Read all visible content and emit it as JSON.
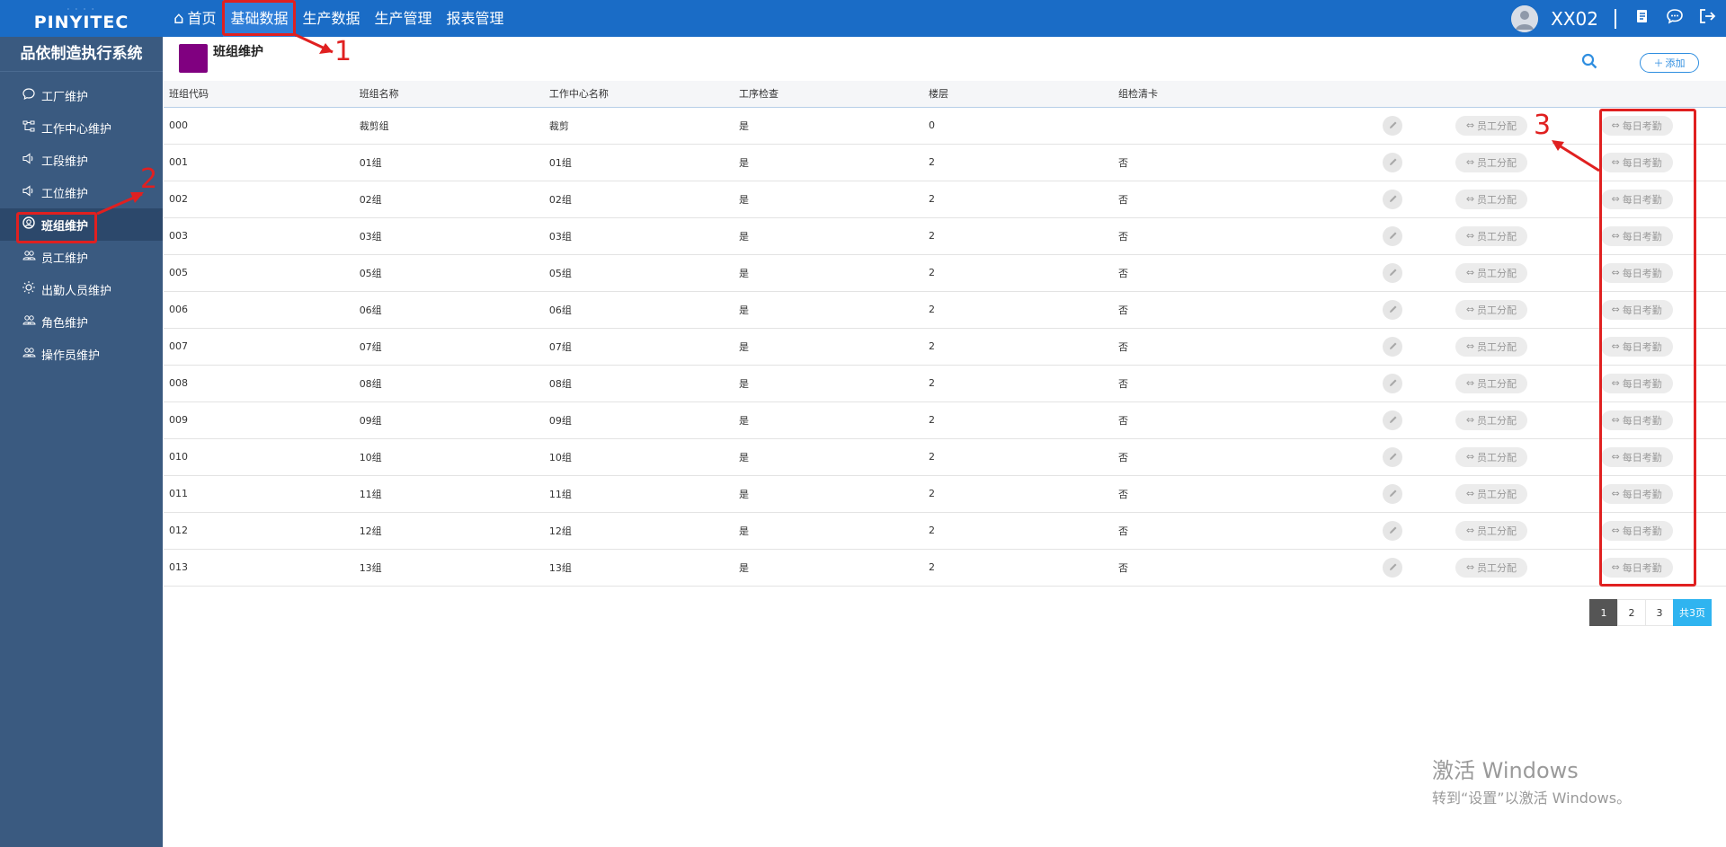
{
  "app": {
    "logo": "PINYITEC",
    "system_title": "品依制造执行系统"
  },
  "nav": {
    "items": [
      {
        "label": "首页",
        "icon": "home-icon"
      },
      {
        "label": "基础数据",
        "active": true
      },
      {
        "label": "生产数据"
      },
      {
        "label": "生产管理"
      },
      {
        "label": "报表管理"
      }
    ]
  },
  "user": {
    "name": "XX02"
  },
  "sidebar": {
    "items": [
      {
        "label": "工厂维护",
        "icon": "chat-icon"
      },
      {
        "label": "工作中心维护",
        "icon": "sitemap-icon"
      },
      {
        "label": "工段维护",
        "icon": "speaker-icon"
      },
      {
        "label": "工位维护",
        "icon": "speaker-icon"
      },
      {
        "label": "班组维护",
        "icon": "user-circle-icon",
        "active": true
      },
      {
        "label": "员工维护",
        "icon": "users-icon"
      },
      {
        "label": "出勤人员维护",
        "icon": "sun-icon"
      },
      {
        "label": "角色维护",
        "icon": "users-icon"
      },
      {
        "label": "操作员维护",
        "icon": "users-icon"
      }
    ]
  },
  "page": {
    "title": "班组维护",
    "add_label": "添加",
    "columns": [
      "班组代码",
      "班组名称",
      "工作中心名称",
      "工序检查",
      "楼层",
      "组检清卡"
    ],
    "action_assign": "员工分配",
    "action_attend": "每日考勤",
    "rows": [
      {
        "code": "000",
        "name": "裁剪组",
        "center": "裁剪",
        "check": "是",
        "floor": "0",
        "card": ""
      },
      {
        "code": "001",
        "name": "01组",
        "center": "01组",
        "check": "是",
        "floor": "2",
        "card": "否"
      },
      {
        "code": "002",
        "name": "02组",
        "center": "02组",
        "check": "是",
        "floor": "2",
        "card": "否"
      },
      {
        "code": "003",
        "name": "03组",
        "center": "03组",
        "check": "是",
        "floor": "2",
        "card": "否"
      },
      {
        "code": "005",
        "name": "05组",
        "center": "05组",
        "check": "是",
        "floor": "2",
        "card": "否"
      },
      {
        "code": "006",
        "name": "06组",
        "center": "06组",
        "check": "是",
        "floor": "2",
        "card": "否"
      },
      {
        "code": "007",
        "name": "07组",
        "center": "07组",
        "check": "是",
        "floor": "2",
        "card": "否"
      },
      {
        "code": "008",
        "name": "08组",
        "center": "08组",
        "check": "是",
        "floor": "2",
        "card": "否"
      },
      {
        "code": "009",
        "name": "09组",
        "center": "09组",
        "check": "是",
        "floor": "2",
        "card": "否"
      },
      {
        "code": "010",
        "name": "10组",
        "center": "10组",
        "check": "是",
        "floor": "2",
        "card": "否"
      },
      {
        "code": "011",
        "name": "11组",
        "center": "11组",
        "check": "是",
        "floor": "2",
        "card": "否"
      },
      {
        "code": "012",
        "name": "12组",
        "center": "12组",
        "check": "是",
        "floor": "2",
        "card": "否"
      },
      {
        "code": "013",
        "name": "13组",
        "center": "13组",
        "check": "是",
        "floor": "2",
        "card": "否"
      }
    ]
  },
  "pagination": {
    "pages": [
      "1",
      "2",
      "3"
    ],
    "current": "1",
    "total_label": "共3页"
  },
  "annotations": {
    "labels": [
      "1",
      "2",
      "3"
    ],
    "color": "#e02020"
  },
  "watermark": {
    "line1": "激活 Windows",
    "line2": "转到“设置”以激活 Windows。"
  },
  "colors": {
    "topbar": "#1a6cc6",
    "sidebar": "#3a5a80",
    "accent": "#2f8ee0",
    "page_icon": "#800080"
  }
}
